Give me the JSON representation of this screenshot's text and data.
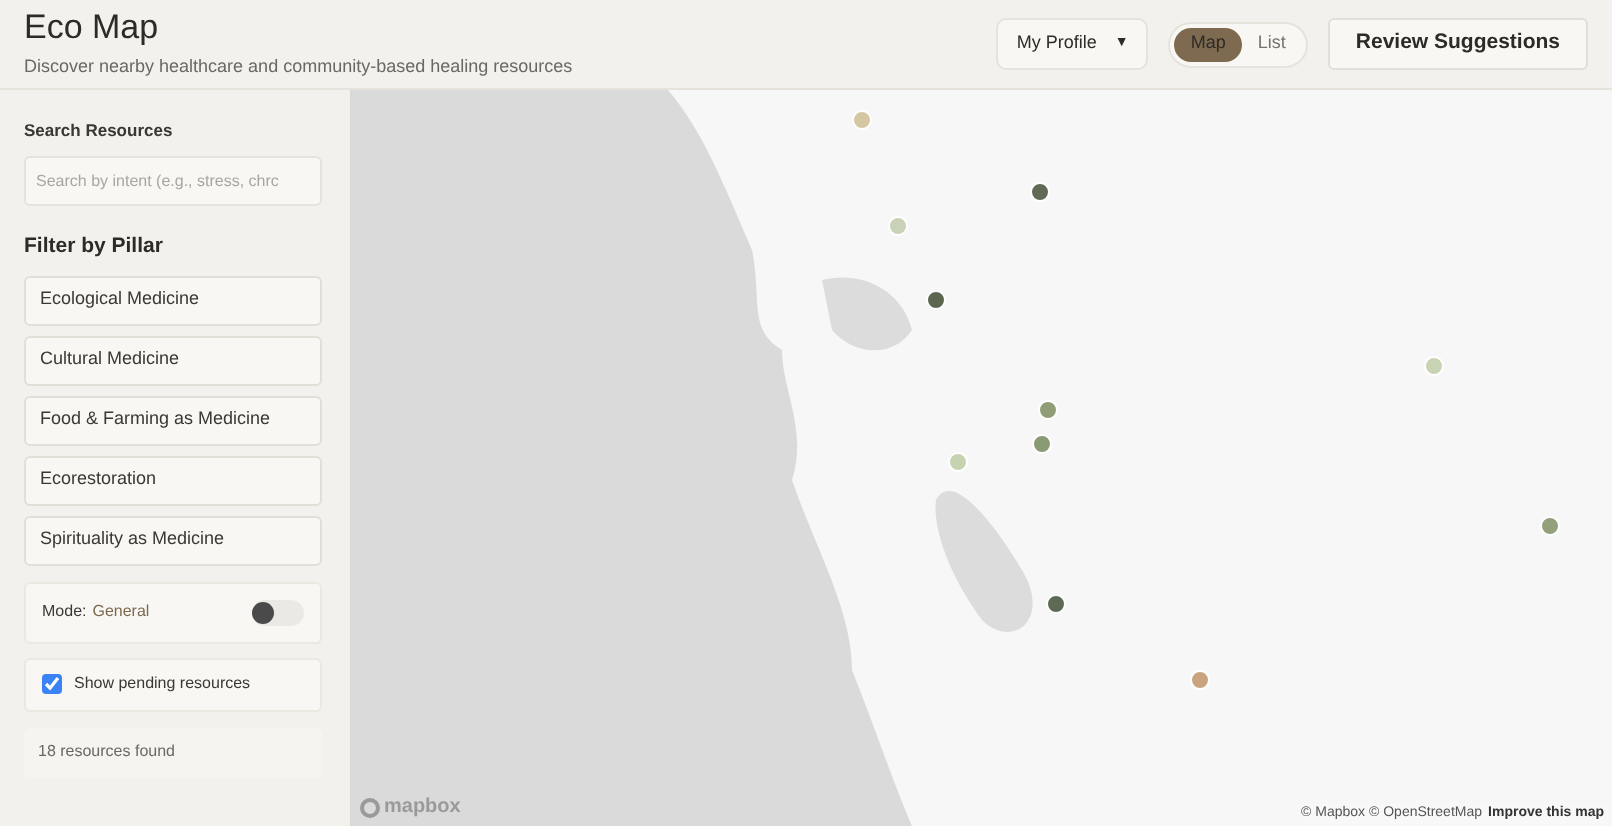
{
  "header": {
    "title": "Eco Map",
    "subtitle": "Discover nearby healthcare and community-based healing resources"
  },
  "profile_menu": {
    "label": "My Profile",
    "caret": "▼"
  },
  "view_tabs": [
    {
      "label": "Map",
      "selected": true
    },
    {
      "label": "List",
      "selected": false
    }
  ],
  "review_button": {
    "label": "Review Suggestions"
  },
  "sidebar": {
    "search": {
      "label": "Search Resources",
      "placeholder": "Search by intent (e.g., stress, chrc"
    },
    "filter_heading": "Filter by Pillar",
    "pillars": [
      {
        "label": "Ecological Medicine",
        "selected": false
      },
      {
        "label": "Cultural Medicine",
        "selected": false
      },
      {
        "label": "Food & Farming as Medicine",
        "selected": false
      },
      {
        "label": "Ecorestoration",
        "selected": false
      },
      {
        "label": "Spirituality as Medicine",
        "selected": false
      }
    ],
    "mode": {
      "label": "Mode:",
      "value": "General",
      "on": false
    },
    "pending": {
      "label": "Show pending resources",
      "checked": true
    },
    "result_count": "18 resources found"
  },
  "map": {
    "markers": [
      {
        "color": "#d6c7a3"
      },
      {
        "color": "#5f6b55"
      },
      {
        "color": "#c9d1b7"
      },
      {
        "color": "#5b6651"
      },
      {
        "color": "#909e78"
      },
      {
        "color": "#8a9a72"
      },
      {
        "color": "#c6d3b1"
      },
      {
        "color": "#c8d3b3"
      },
      {
        "color": "#94a07c"
      },
      {
        "color": "#5e6a54"
      },
      {
        "color": "#c9a47e"
      }
    ],
    "logo": "mapbox",
    "attribution": "© Mapbox © OpenStreetMap",
    "improve_link": "Improve this map"
  }
}
